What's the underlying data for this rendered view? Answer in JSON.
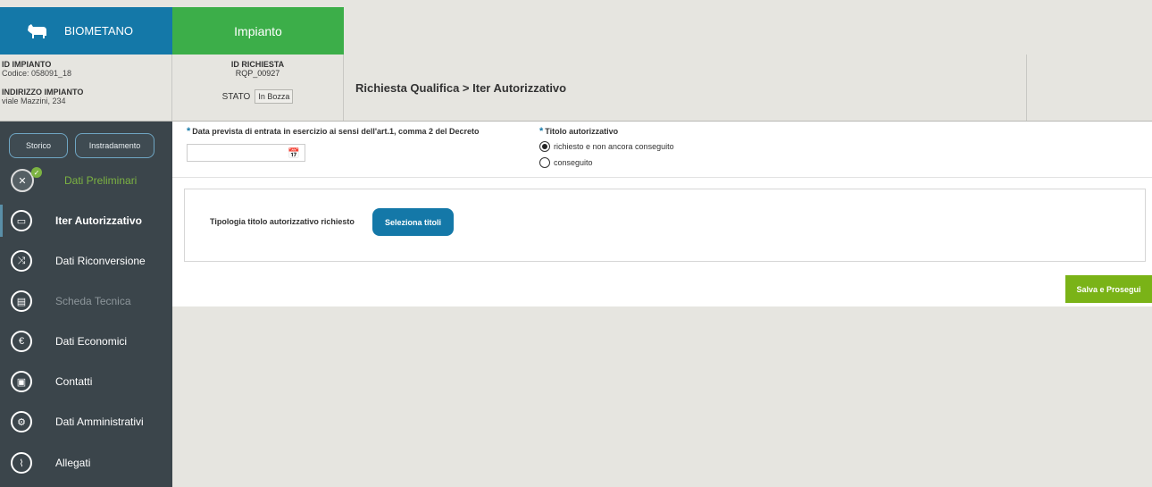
{
  "header": {
    "brand_label": "BIOMETANO",
    "tab_label": "Impianto",
    "breadcrumb": "Richiesta Qualifica > Iter Autorizzativo"
  },
  "info": {
    "id_impianto_label": "ID IMPIANTO",
    "id_impianto_value": "Codice: 058091_18",
    "indirizzo_label": "INDIRIZZO IMPIANTO",
    "indirizzo_value": "viale Mazzini, 234",
    "id_richiesta_label": "ID RICHIESTA",
    "id_richiesta_value": "RQP_00927",
    "stato_label": "STATO",
    "stato_value": "In Bozza"
  },
  "sidebar": {
    "storico_label": "Storico",
    "instradamento_label": "Instradamento",
    "items": [
      {
        "label": "Dati Preliminari",
        "icon": "tools-icon",
        "state": "done"
      },
      {
        "label": "Iter Autorizzativo",
        "icon": "document-icon",
        "state": "active"
      },
      {
        "label": "Dati Riconversione",
        "icon": "shuffle-icon",
        "state": "normal"
      },
      {
        "label": "Scheda Tecnica",
        "icon": "sheet-icon",
        "state": "disabled"
      },
      {
        "label": "Dati Economici",
        "icon": "euro-icon",
        "state": "normal"
      },
      {
        "label": "Contatti",
        "icon": "contacts-icon",
        "state": "normal"
      },
      {
        "label": "Dati Amministrativi",
        "icon": "wrench-icon",
        "state": "normal"
      },
      {
        "label": "Allegati",
        "icon": "paperclip-icon",
        "state": "normal"
      }
    ]
  },
  "form": {
    "date_label": "Data prevista di entrata in esercizio ai sensi dell'art.1, comma 2 del Decreto",
    "date_value": "",
    "titolo_label": "Titolo autorizzativo",
    "radio_options": [
      "richiesto e non ancora conseguito",
      "conseguito"
    ],
    "radio_selected": "richiesto e non ancora conseguito",
    "tipologia_label": "Tipologia titolo autorizzativo richiesto",
    "seleziona_label": "Seleziona titoli",
    "save_label": "Salva e Prosegui"
  },
  "colors": {
    "brand_blue": "#1478a8",
    "tab_green": "#3cae49",
    "sidebar_bg": "#3b454b",
    "save_green": "#7ab317"
  }
}
